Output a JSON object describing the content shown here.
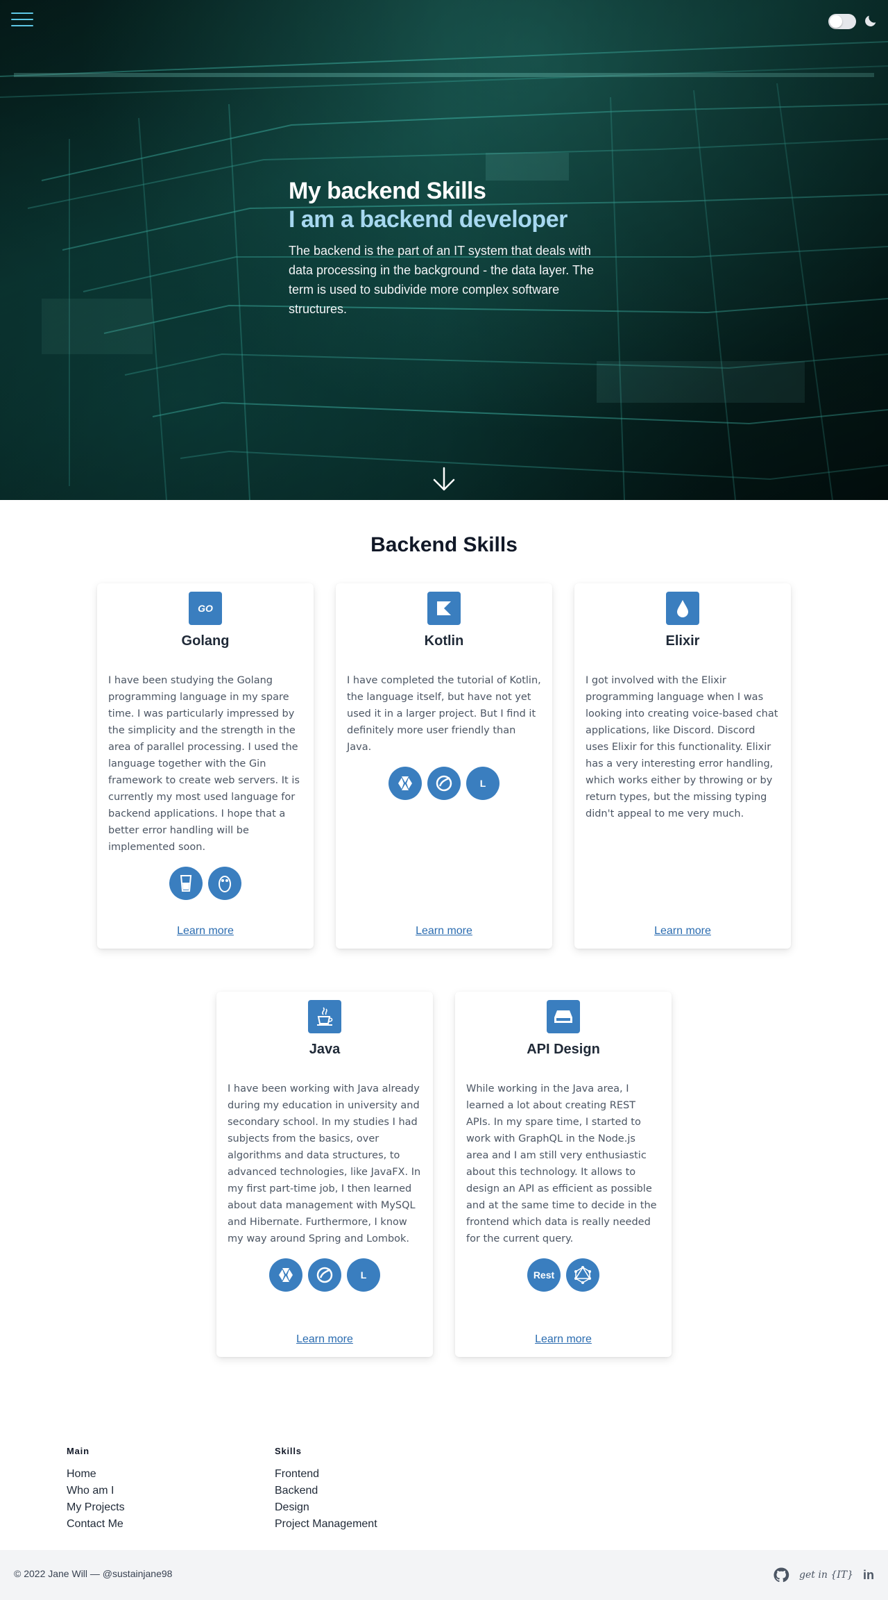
{
  "header": {
    "menu_icon": "hamburger-icon",
    "theme_icon": "moon-icon"
  },
  "hero": {
    "title": "My backend Skills",
    "subtitle": "I am a backend developer",
    "description": "The backend is the part of an IT system that deals with data processing in the background - the data layer. The term is used to subdivide more complex software structures.",
    "scroll_icon": "arrow-down-icon"
  },
  "skills": {
    "section_title": "Backend Skills",
    "learn_more": "Learn more",
    "cards": [
      {
        "title": "Golang",
        "icon": "go-icon",
        "icon_text": "GO",
        "text": "I have been studying the Golang programming language in my spare time. I was particularly impressed by the simplicity and the strength in the area of parallel processing. I used the language together with the Gin framework to create web servers. It is currently my most used language for backend applications. I hope that a better error handling will be implemented soon.",
        "tech": [
          {
            "icon": "gin-icon",
            "label": ""
          },
          {
            "icon": "gopher-icon",
            "label": ""
          }
        ]
      },
      {
        "title": "Kotlin",
        "icon": "kotlin-icon",
        "icon_text": "",
        "text": "I have completed the tutorial of Kotlin, the language itself, but have not yet used it in a larger project. But I find it definitely more user friendly than Java.",
        "tech": [
          {
            "icon": "hibernate-icon",
            "label": ""
          },
          {
            "icon": "spring-icon",
            "label": ""
          },
          {
            "icon": "lombok-icon",
            "label": "L"
          }
        ]
      },
      {
        "title": "Elixir",
        "icon": "elixir-drop-icon",
        "icon_text": "",
        "text": "I got involved with the Elixir programming language when I was looking into creating voice-based chat applications, like Discord. Discord uses Elixir for this functionality. Elixir has a very interesting error handling, which works either by throwing or by return types, but the missing typing didn't appeal to me very much.",
        "tech": []
      },
      {
        "title": "Java",
        "icon": "java-cup-icon",
        "icon_text": "",
        "text": "I have been working with Java already during my education in university and secondary school. In my studies I had subjects from the basics, over algorithms and data structures, to advanced technologies, like JavaFX. In my first part-time job, I then learned about data management with MySQL and Hibernate. Furthermore, I know my way around Spring and Lombok.",
        "tech": [
          {
            "icon": "hibernate-icon",
            "label": ""
          },
          {
            "icon": "spring-icon",
            "label": ""
          },
          {
            "icon": "lombok-icon",
            "label": "L"
          }
        ]
      },
      {
        "title": "API Design",
        "icon": "server-icon",
        "icon_text": "",
        "text": "While working in the Java area, I learned a lot about creating REST APIs. In my spare time, I started to work with GraphQL in the Node.js area and I am still very enthusiastic about this technology. It allows to design an API as efficient as possible and at the same time to decide in the frontend which data is really needed for the current query.",
        "tech": [
          {
            "icon": "rest-icon",
            "label": "Rest"
          },
          {
            "icon": "graphql-icon",
            "label": ""
          }
        ]
      }
    ]
  },
  "footer": {
    "main_heading": "Main",
    "main_links": [
      "Home",
      "Who am I",
      "My Projects",
      "Contact Me"
    ],
    "skills_heading": "Skills",
    "skills_links": [
      "Frontend",
      "Backend",
      "Design",
      "Project Management"
    ],
    "copyright": "© 2022 Jane Will — @sustainjane98",
    "getinit_text": "get in {IT}",
    "linkedin_text": "in",
    "social_icons": [
      "github-icon",
      "getinit-icon",
      "linkedin-icon"
    ]
  },
  "colors": {
    "accent": "#3a7ebf",
    "link": "#2b6cb0",
    "hero_subtitle": "#a7d8f0",
    "footer_bar": "#f3f4f6"
  }
}
